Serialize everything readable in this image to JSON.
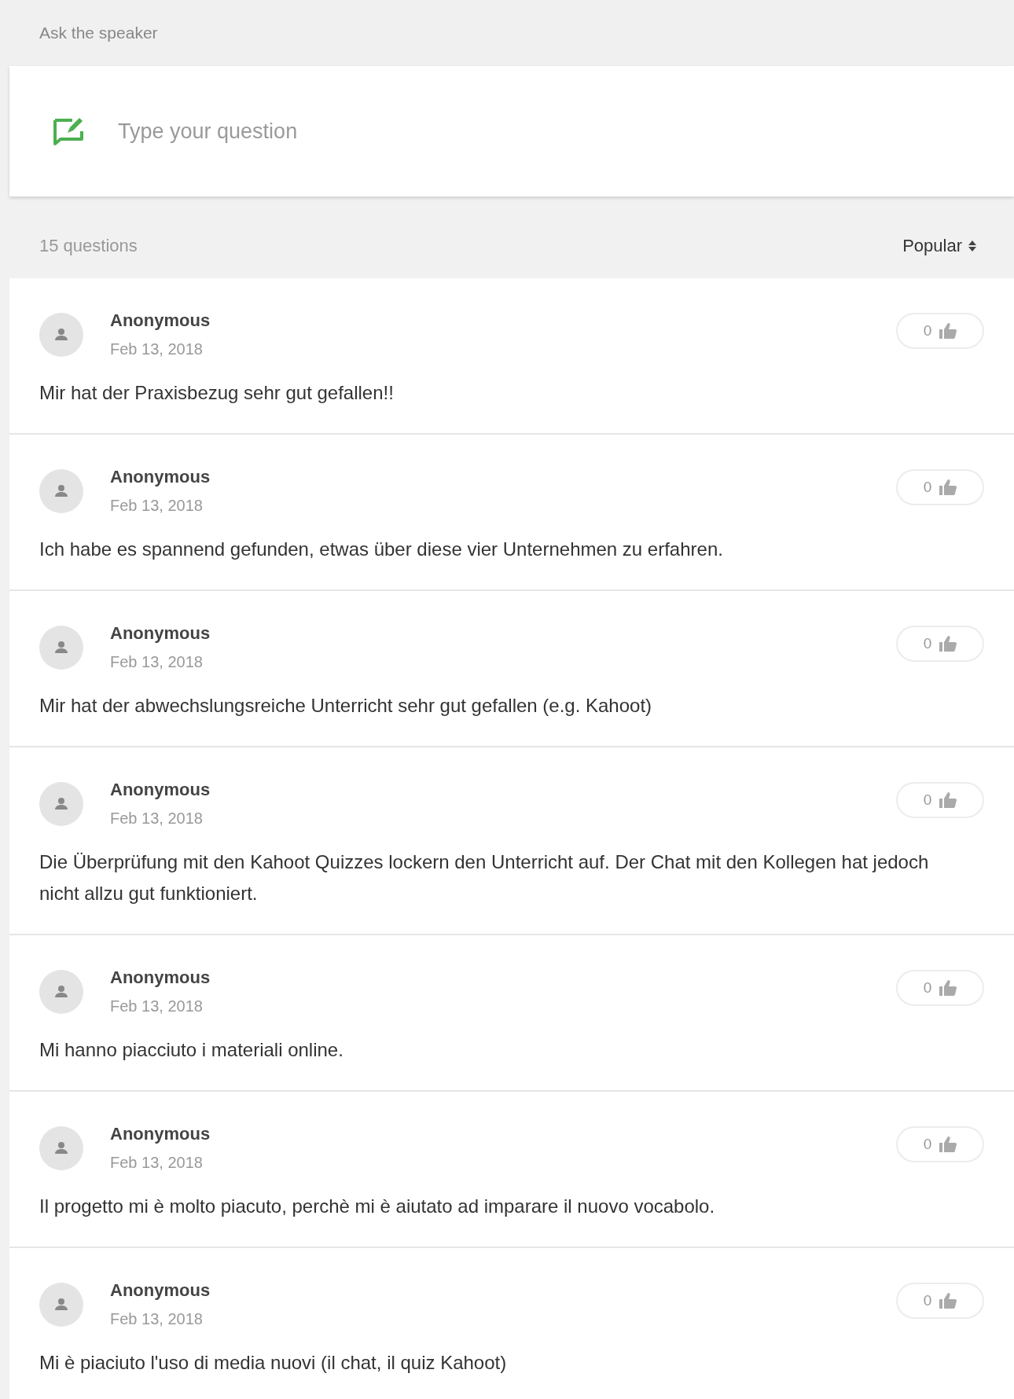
{
  "section_title": "Ask the speaker",
  "input": {
    "placeholder": "Type your question"
  },
  "toolbar": {
    "count": "15 questions",
    "sort": "Popular"
  },
  "questions": [
    {
      "author": "Anonymous",
      "date": "Feb 13, 2018",
      "likes": "0",
      "text": "Mir hat der Praxisbezug sehr gut gefallen!!"
    },
    {
      "author": "Anonymous",
      "date": "Feb 13, 2018",
      "likes": "0",
      "text": "Ich habe es spannend gefunden, etwas über diese vier Unternehmen zu erfahren."
    },
    {
      "author": "Anonymous",
      "date": "Feb 13, 2018",
      "likes": "0",
      "text": "Mir hat der abwechslungsreiche Unterricht sehr gut gefallen (e.g. Kahoot)"
    },
    {
      "author": "Anonymous",
      "date": "Feb 13, 2018",
      "likes": "0",
      "text": "Die Überprüfung mit den Kahoot Quizzes lockern den Unterricht auf. Der Chat mit den Kollegen hat jedoch nicht allzu gut funktioniert."
    },
    {
      "author": "Anonymous",
      "date": "Feb 13, 2018",
      "likes": "0",
      "text": "Mi hanno piacciuto i materiali online."
    },
    {
      "author": "Anonymous",
      "date": "Feb 13, 2018",
      "likes": "0",
      "text": "Il progetto mi è molto piacuto, perchè mi è aiutato ad imparare il nuovo vocabolo."
    },
    {
      "author": "Anonymous",
      "date": "Feb 13, 2018",
      "likes": "0",
      "text": "Mi è piaciuto l'uso di media nuovi (il chat, il quiz Kahoot)"
    }
  ]
}
